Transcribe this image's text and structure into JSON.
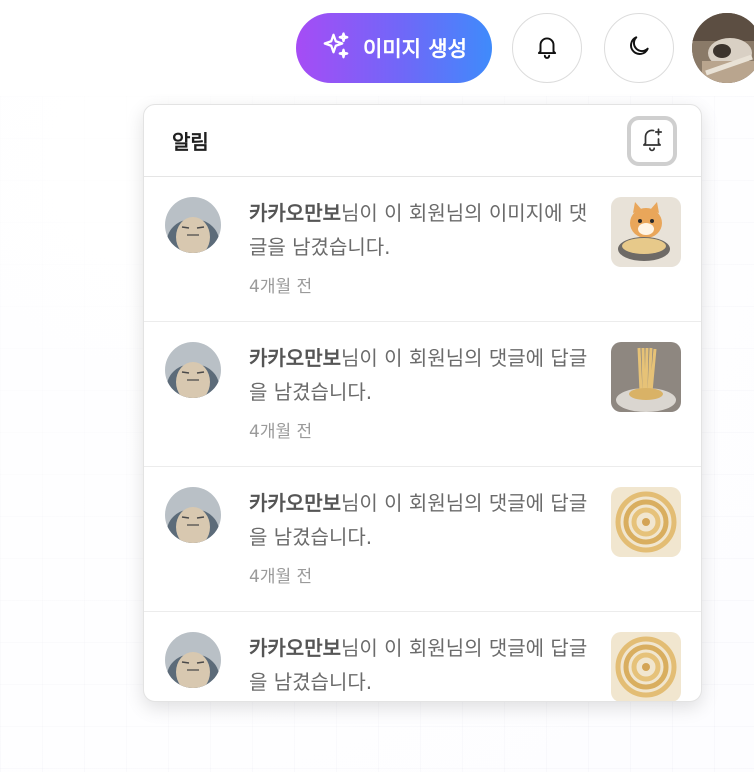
{
  "header": {
    "generate_label": "이미지 생성",
    "generate_icon": "sparkles-icon",
    "notification_icon": "bell-icon",
    "theme_icon": "moon-icon",
    "accent_gradient": [
      "#a64cf5",
      "#3f8bfb"
    ]
  },
  "panel": {
    "title": "알림",
    "action_icon": "bell-plus-icon"
  },
  "notifications": [
    {
      "author": "카카오만보",
      "message": "님이 이 회원님의 이미지에 댓글을 남겼습니다.",
      "time": "4개월 전",
      "thumb": "cat-noodles"
    },
    {
      "author": "카카오만보",
      "message": "님이 이 회원님의 댓글에 답글을 남겼습니다.",
      "time": "4개월 전",
      "thumb": "spaghetti-fork"
    },
    {
      "author": "카카오만보",
      "message": "님이 이 회원님의 댓글에 답글을 남겼습니다.",
      "time": "4개월 전",
      "thumb": "spaghetti-nest"
    },
    {
      "author": "카카오만보",
      "message": "님이 이 회원님의 댓글에 답글을 남겼습니다.",
      "time": "",
      "thumb": "spaghetti-nest"
    }
  ]
}
